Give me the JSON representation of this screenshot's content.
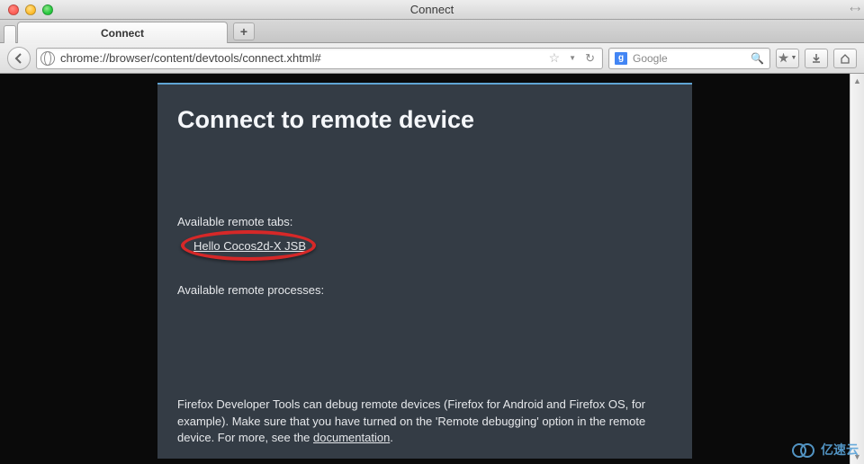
{
  "window": {
    "title": "Connect"
  },
  "tab": {
    "title": "Connect"
  },
  "urlbar": {
    "value": "chrome://browser/content/devtools/connect.xhtml#"
  },
  "searchbar": {
    "placeholder": "Google",
    "engine_letter": "g"
  },
  "panel": {
    "heading": "Connect to remote device",
    "available_tabs_label": "Available remote tabs:",
    "remote_tab_link": "Hello Cocos2d-X JSB",
    "available_processes_label": "Available remote processes:",
    "info_part1": "Firefox Developer Tools can debug remote devices (Firefox for Android and Firefox OS, for example). Make sure that you have turned on the 'Remote debugging' option in the remote device. For more, see the ",
    "info_link": "documentation",
    "info_part2": "."
  },
  "watermark": {
    "text": "亿速云"
  }
}
